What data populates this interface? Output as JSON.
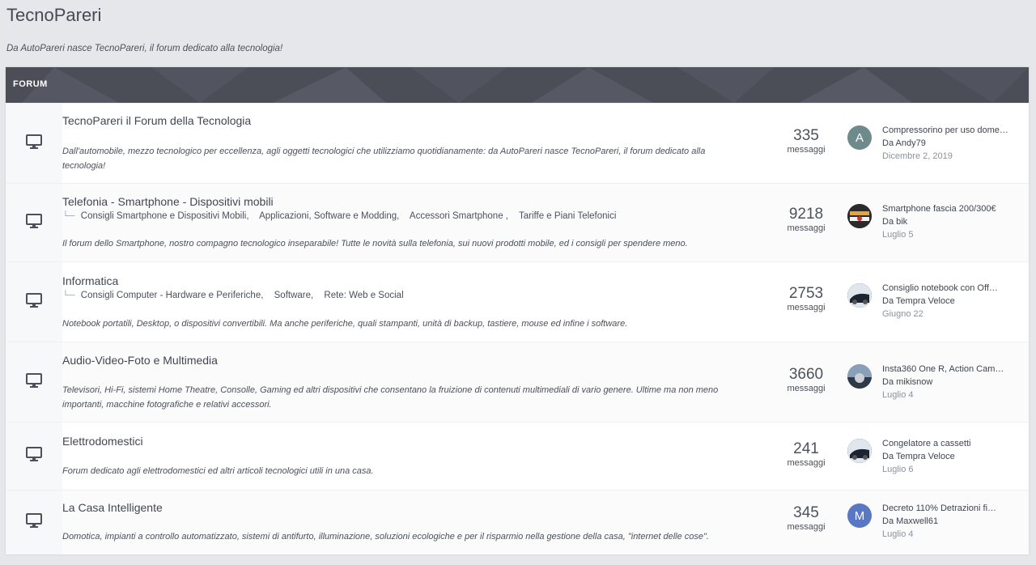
{
  "site": {
    "title": "TecnoPareri",
    "tagline": "Da AutoPareri nasce TecnoPareri, il forum dedicato alla tecnologia!"
  },
  "forum_header": {
    "label": "FORUM"
  },
  "colors": {
    "header_bg": "#4b4d57",
    "avatar_a": "#6f8a8c",
    "avatar_m": "#5a77c4"
  },
  "forums": [
    {
      "icon": "monitor-icon",
      "title": "TecnoPareri il Forum della Tecnologia",
      "subforums": [],
      "description": "Dall'automobile, mezzo tecnologico per eccellenza, agli oggetti tecnologici che utilizziamo quotidianamente: da AutoPareri nasce TecnoPareri, il forum dedicato alla tecnologia!",
      "count": "335",
      "count_label": "messaggi",
      "last_post": {
        "avatar_letter": "A",
        "title": "Compressorino per uso dome…",
        "author": "Da Andy79",
        "date": "Dicembre 2, 2019"
      }
    },
    {
      "icon": "monitor-icon",
      "title": "Telefonia - Smartphone - Dispositivi mobili",
      "subforums": [
        "Consigli Smartphone e Dispositivi Mobili,",
        "Applicazioni, Software e Modding,",
        "Accessori Smartphone ,",
        "Tariffe e Piani Telefonici"
      ],
      "description": "Il forum dello Smartphone, nostro compagno tecnologico inseparabile! Tutte le novità sulla telefonia, sui nuovi prodotti mobile, ed i consigli per spendere meno.",
      "count": "9218",
      "count_label": "messaggi",
      "last_post": {
        "avatar_letter": "",
        "title": "Smartphone fascia 200/300€",
        "author": "Da bik",
        "date": "Luglio 5"
      }
    },
    {
      "icon": "monitor-icon",
      "title": "Informatica",
      "subforums": [
        "Consigli Computer - Hardware e Periferiche,",
        "Software,",
        "Rete: Web e Social"
      ],
      "description": "Notebook portatili, Desktop, o dispositivi convertibili. Ma anche periferiche, quali stampanti, unità di backup, tastiere, mouse ed infine i software.",
      "count": "2753",
      "count_label": "messaggi",
      "last_post": {
        "avatar_letter": "",
        "title": "Consiglio notebook con Off…",
        "author": "Da Tempra Veloce",
        "date": "Giugno 22"
      }
    },
    {
      "icon": "monitor-icon",
      "title": "Audio-Video-Foto e Multimedia",
      "subforums": [],
      "description": "Televisori, Hi-Fi, sistemi Home Theatre, Consolle, Gaming ed altri dispositivi che consentano la fruizione di contenuti multimediali di vario genere. Ultime ma non meno importanti, macchine fotografiche e relativi accessori.",
      "count": "3660",
      "count_label": "messaggi",
      "last_post": {
        "avatar_letter": "",
        "title": "Insta360 One R, Action Cam…",
        "author": "Da mikisnow",
        "date": "Luglio 4"
      }
    },
    {
      "icon": "monitor-icon",
      "title": "Elettrodomestici",
      "subforums": [],
      "description": "Forum dedicato agli elettrodomestici ed altri articoli tecnologici utili in una casa.",
      "count": "241",
      "count_label": "messaggi",
      "last_post": {
        "avatar_letter": "",
        "title": "Congelatore a cassetti",
        "author": "Da Tempra Veloce",
        "date": "Luglio 6"
      }
    },
    {
      "icon": "monitor-icon",
      "title": "La Casa Intelligente",
      "subforums": [],
      "description": "Domotica, impianti a controllo automatizzato, sistemi di antifurto, illuminazione, soluzioni ecologiche e per il risparmio nella gestione della casa, \"internet delle cose\".",
      "count": "345",
      "count_label": "messaggi",
      "last_post": {
        "avatar_letter": "M",
        "title": "Decreto 110% Detrazioni fi…",
        "author": "Da Maxwell61",
        "date": "Luglio 4"
      }
    }
  ]
}
